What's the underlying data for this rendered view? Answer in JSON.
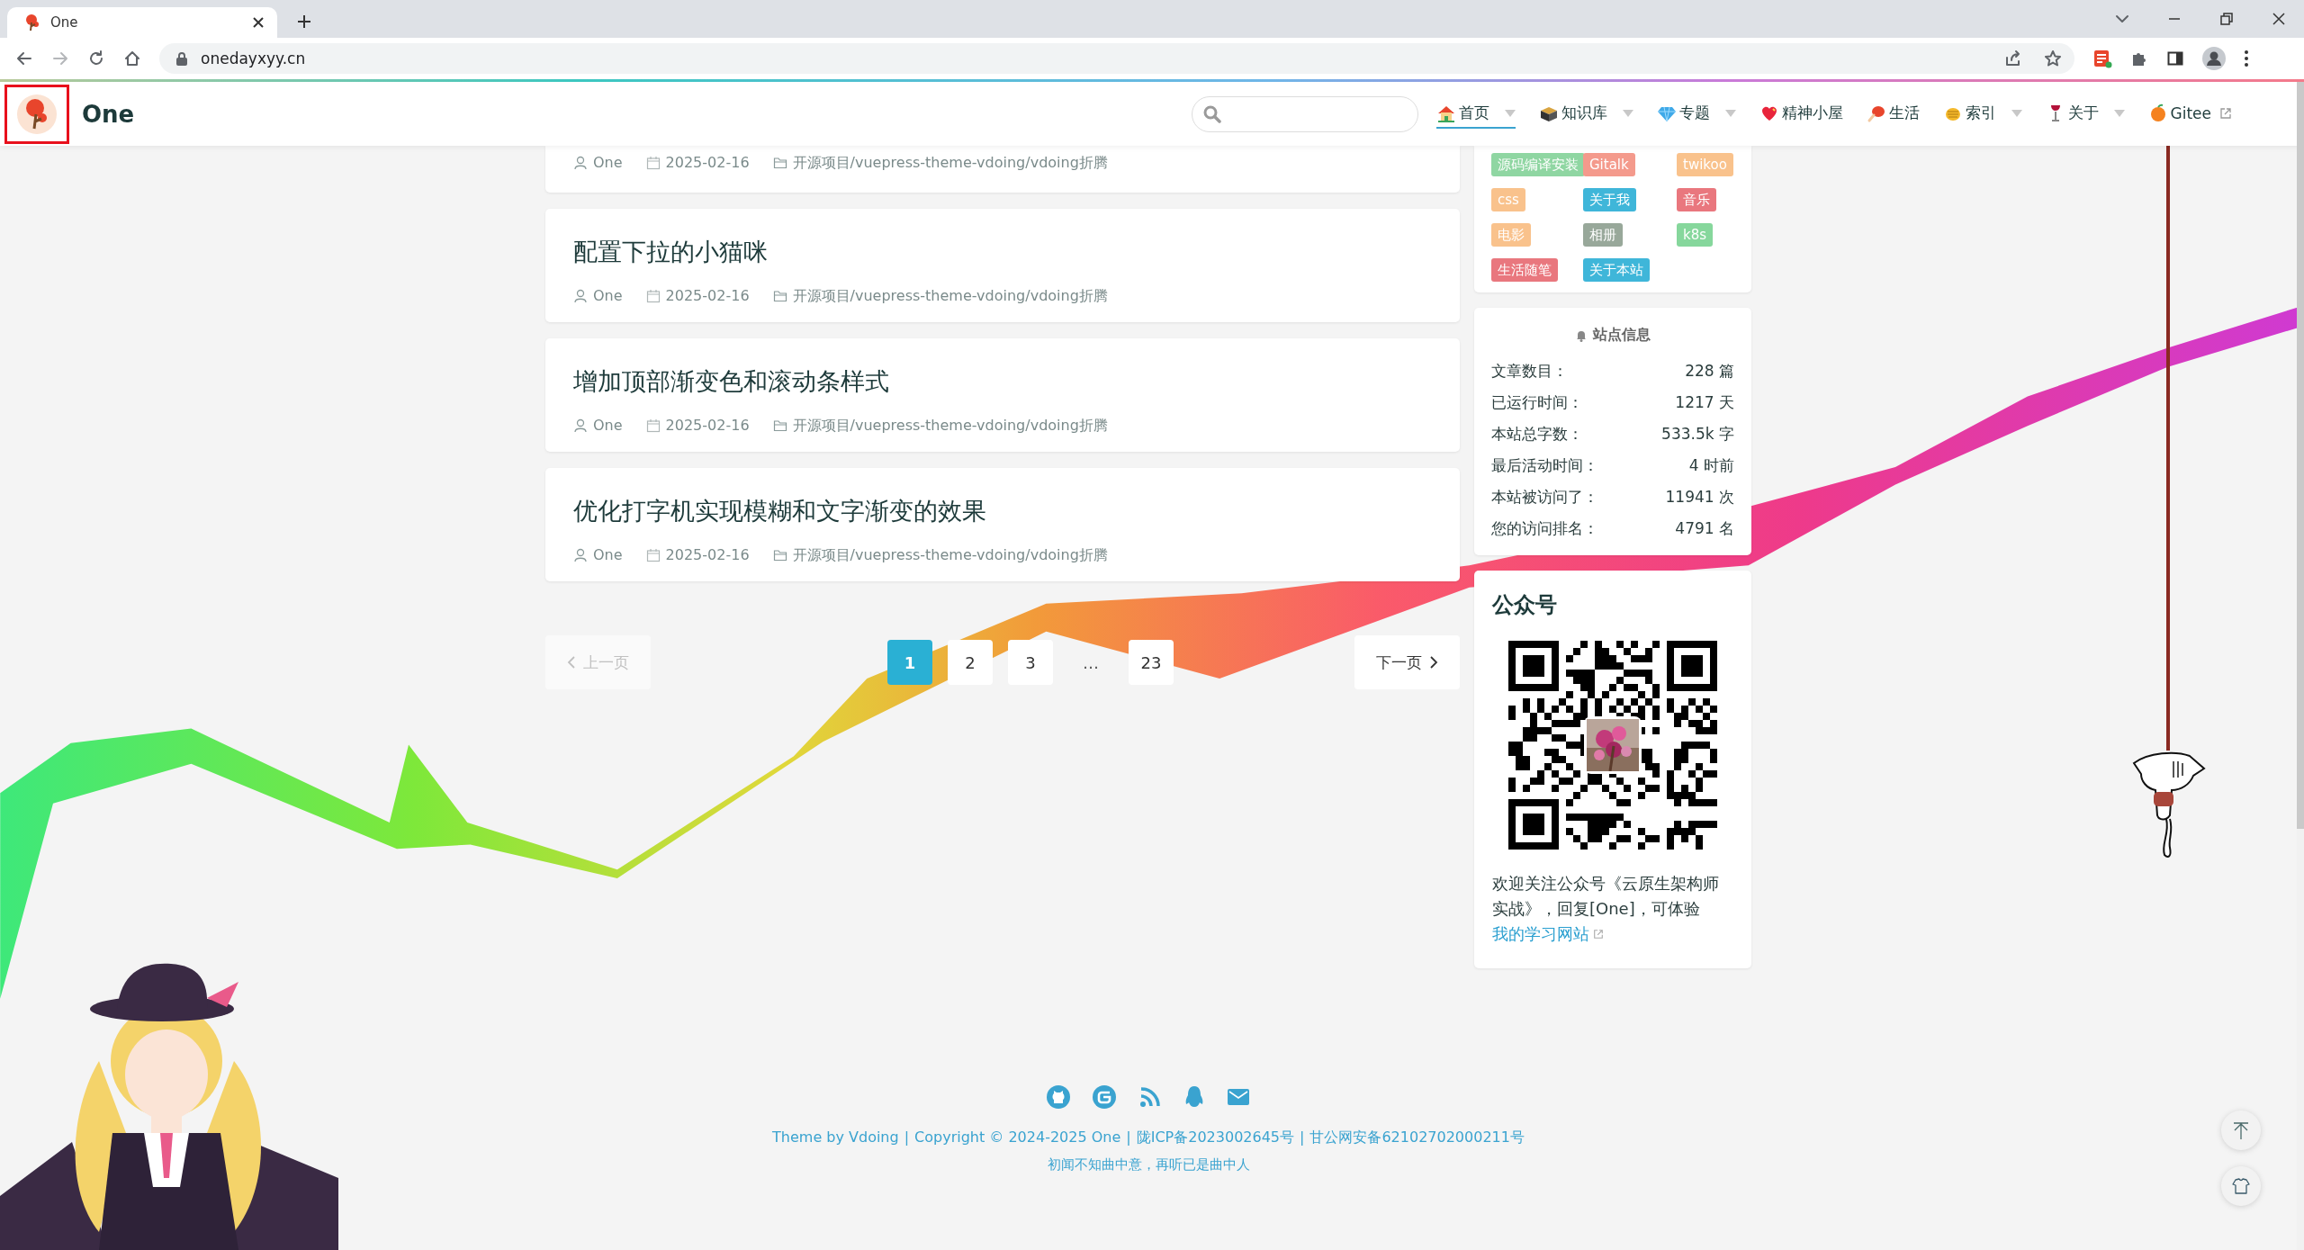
{
  "browser": {
    "tab_title": "One",
    "url": "onedayxyy.cn"
  },
  "header": {
    "site_name": "One"
  },
  "nav": [
    {
      "label": "首页",
      "selected": true,
      "dropdown": true,
      "external": false
    },
    {
      "label": "知识库",
      "selected": false,
      "dropdown": true,
      "external": false
    },
    {
      "label": "专题",
      "selected": false,
      "dropdown": true,
      "external": false
    },
    {
      "label": "精神小屋",
      "selected": false,
      "dropdown": false,
      "external": false
    },
    {
      "label": "生活",
      "selected": false,
      "dropdown": false,
      "external": false
    },
    {
      "label": "索引",
      "selected": false,
      "dropdown": true,
      "external": false
    },
    {
      "label": "关于",
      "selected": false,
      "dropdown": true,
      "external": false
    },
    {
      "label": "Gitee",
      "selected": false,
      "dropdown": false,
      "external": true
    }
  ],
  "articles": [
    {
      "author": "One",
      "date": "2025-02-16",
      "category": "开源项目/vuepress-theme-vdoing/vdoing折腾"
    },
    {
      "title": "配置下拉的小猫咪",
      "author": "One",
      "date": "2025-02-16",
      "category": "开源项目/vuepress-theme-vdoing/vdoing折腾"
    },
    {
      "title": "增加顶部渐变色和滚动条样式",
      "author": "One",
      "date": "2025-02-16",
      "category": "开源项目/vuepress-theme-vdoing/vdoing折腾"
    },
    {
      "title": "优化打字机实现模糊和文字渐变的效果",
      "author": "One",
      "date": "2025-02-16",
      "category": "开源项目/vuepress-theme-vdoing/vdoing折腾"
    }
  ],
  "pagination": {
    "prev": "上一页",
    "prev_disabled": true,
    "next": "下一页",
    "next_disabled": false,
    "pages": [
      {
        "label": "1",
        "kind": "page",
        "selected": true
      },
      {
        "label": "2",
        "kind": "page",
        "selected": false
      },
      {
        "label": "3",
        "kind": "page",
        "selected": false
      },
      {
        "label": "…",
        "kind": "ellipsis"
      },
      {
        "label": "23",
        "kind": "page",
        "selected": false
      }
    ]
  },
  "tags": [
    {
      "label": "源码编译安装",
      "color": "#8fd6a2"
    },
    {
      "label": "Gitalk",
      "color": "#f49a8c"
    },
    {
      "label": "twikoo",
      "color": "#f9c28c"
    },
    {
      "label": "css",
      "color": "#f9c28c"
    },
    {
      "label": "关于我",
      "color": "#3fb6d9"
    },
    {
      "label": "音乐",
      "color": "#e9777e"
    },
    {
      "label": "电影",
      "color": "#f9c28c"
    },
    {
      "label": "相册",
      "color": "#98a89a"
    },
    {
      "label": "k8s",
      "color": "#86d79c"
    },
    {
      "label": "生活随笔",
      "color": "#e9777e"
    },
    {
      "label": "关于本站",
      "color": "#3fb6d9"
    }
  ],
  "site_info": {
    "title": "站点信息",
    "rows": [
      {
        "label": "文章数目：",
        "value": "228 篇"
      },
      {
        "label": "已运行时间：",
        "value": "1217 天"
      },
      {
        "label": "本站总字数：",
        "value": "533.5k 字"
      },
      {
        "label": "最后活动时间：",
        "value": "4 时前"
      },
      {
        "label": "本站被访问了：",
        "value": "11941 次"
      },
      {
        "label": "您的访问排名：",
        "value": "4791 名"
      }
    ]
  },
  "wechat": {
    "title": "公众号",
    "text": "欢迎关注公众号《云原生架构师实战》，回复[One]，可体验",
    "link": "我的学习网站"
  },
  "footer": {
    "separator": "|",
    "links": [
      "Theme by Vdoing",
      "Copyright © 2024-2025 One",
      "陇ICP备2023002645号",
      "甘公网安备62102702000211号"
    ],
    "motto": "初闻不知曲中意，再听已是曲中人"
  }
}
